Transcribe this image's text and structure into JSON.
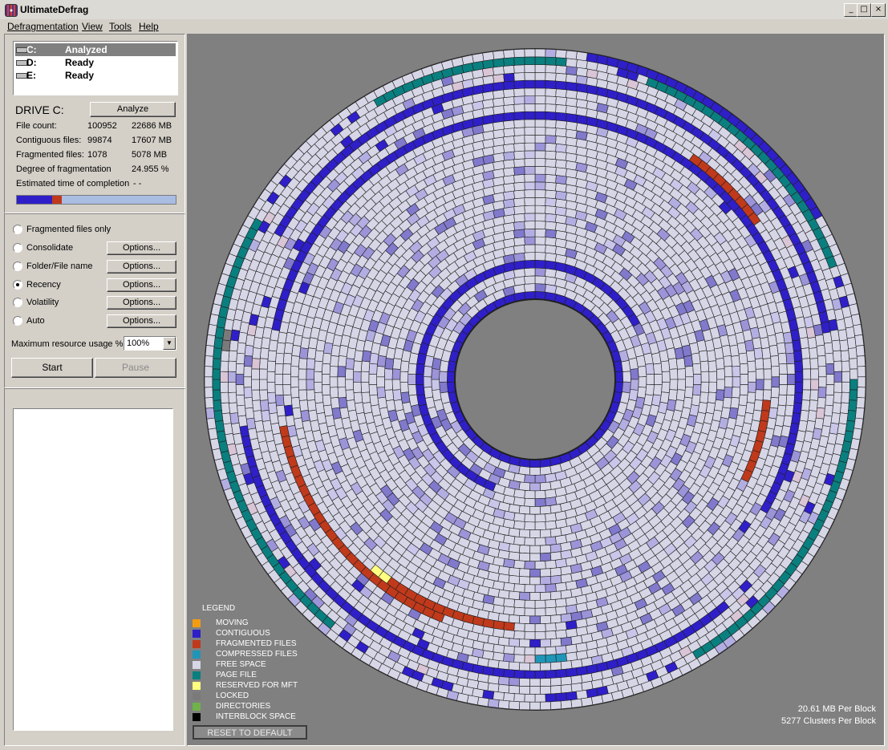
{
  "window": {
    "title": "UltimateDefrag",
    "min": "_",
    "max": "□",
    "close": "×"
  },
  "menu": [
    "Defragmentation",
    "View",
    "Tools",
    "Help"
  ],
  "drives": [
    {
      "letter": "C:",
      "status": "Analyzed",
      "selected": true
    },
    {
      "letter": "D:",
      "status": "Ready",
      "selected": false
    },
    {
      "letter": "E:",
      "status": "Ready",
      "selected": false
    }
  ],
  "drive_info": {
    "heading": "DRIVE C:",
    "analyze_label": "Analyze",
    "rows": [
      {
        "label": "File count:",
        "v1": "100952",
        "v2": "22686 MB"
      },
      {
        "label": "Contiguous files:",
        "v1": "99874",
        "v2": "17607 MB"
      },
      {
        "label": "Fragmented files:",
        "v1": "1078",
        "v2": "5078 MB"
      },
      {
        "label": "Degree of fragmentation",
        "v1": "",
        "v2": "24.955 %"
      },
      {
        "label": "Estimated time of completion",
        "v1": "",
        "v2": "- -"
      }
    ],
    "progress": {
      "contiguous_fraction": 0.22,
      "fragmented_fraction": 0.06
    }
  },
  "options": {
    "modes": [
      {
        "label": "Fragmented files only",
        "selected": false,
        "has_options": false
      },
      {
        "label": "Consolidate",
        "selected": false,
        "has_options": true
      },
      {
        "label": "Folder/File name",
        "selected": false,
        "has_options": true
      },
      {
        "label": "Recency",
        "selected": true,
        "has_options": true
      },
      {
        "label": "Volatility",
        "selected": false,
        "has_options": true
      },
      {
        "label": "Auto",
        "selected": false,
        "has_options": true
      }
    ],
    "options_label": "Options...",
    "resource_label": "Maximum resource usage %",
    "resource_value": "100%",
    "start_label": "Start",
    "pause_label": "Pause"
  },
  "legend": {
    "title": "LEGEND",
    "items": [
      {
        "label": "MOVING",
        "color": "#f39c12"
      },
      {
        "label": "CONTIGUOUS",
        "color": "#2f1fc8"
      },
      {
        "label": "FRAGMENTED FILES",
        "color": "#c0391b"
      },
      {
        "label": "COMPRESSED FILES",
        "color": "#1f96b8"
      },
      {
        "label": "FREE SPACE",
        "color": "#d6d6e6"
      },
      {
        "label": "PAGE FILE",
        "color": "#0a7f7f"
      },
      {
        "label": "RESERVED FOR MFT",
        "color": "#ffff80"
      },
      {
        "label": "LOCKED",
        "color": "#7a7a7a"
      },
      {
        "label": "DIRECTORIES",
        "color": "#6fb24a"
      },
      {
        "label": "INTERBLOCK SPACE",
        "color": "#000000"
      }
    ],
    "reset_label": "RESET TO DEFAULT"
  },
  "block_info": {
    "mb_per_block": "20.61 MB Per Block",
    "clusters_per_block": "5277 Clusters Per Block"
  },
  "colors": {
    "free": "#d6d6e6",
    "contiguous": "#2f1fc8",
    "fragmented": "#c0391b",
    "pagefile": "#0a7f7f",
    "mft": "#ffff80",
    "compressed": "#1f96b8",
    "locked": "#7a7a7a",
    "light_purples": [
      "#c9c6ea",
      "#b3aee2",
      "#9b94d8",
      "#8079cc",
      "#d9c5d6"
    ]
  }
}
